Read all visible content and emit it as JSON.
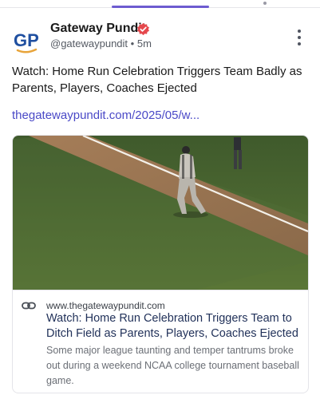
{
  "post": {
    "author_name": "Gateway Pundit",
    "avatar_initials": "GP",
    "handle": "@gatewaypundit",
    "separator": "•",
    "time_ago": "5m",
    "text": "Watch: Home Run Celebration Triggers Team Badly as Parents, Players, Coaches Ejected",
    "link_text": "thegatewaypundit.com/2025/05/w..."
  },
  "link_card": {
    "domain": "www.thegatewaypundit.com",
    "title": "Watch: Home Run Celebration Triggers Team to Ditch Field as Parents, Players, Coaches Ejected",
    "description": "Some major league taunting and temper tantrums broke out during a weekend NCAA college tournament baseball game."
  },
  "icons": {
    "verified": "verified-badge-icon",
    "more": "more-vertical-icon",
    "link": "link-icon"
  },
  "colors": {
    "brand_blue": "#1f4fa0",
    "brand_orange": "#e8a43a",
    "verified": "#e5484d",
    "link": "#4a49c7",
    "accent": "#6d5bd0"
  }
}
